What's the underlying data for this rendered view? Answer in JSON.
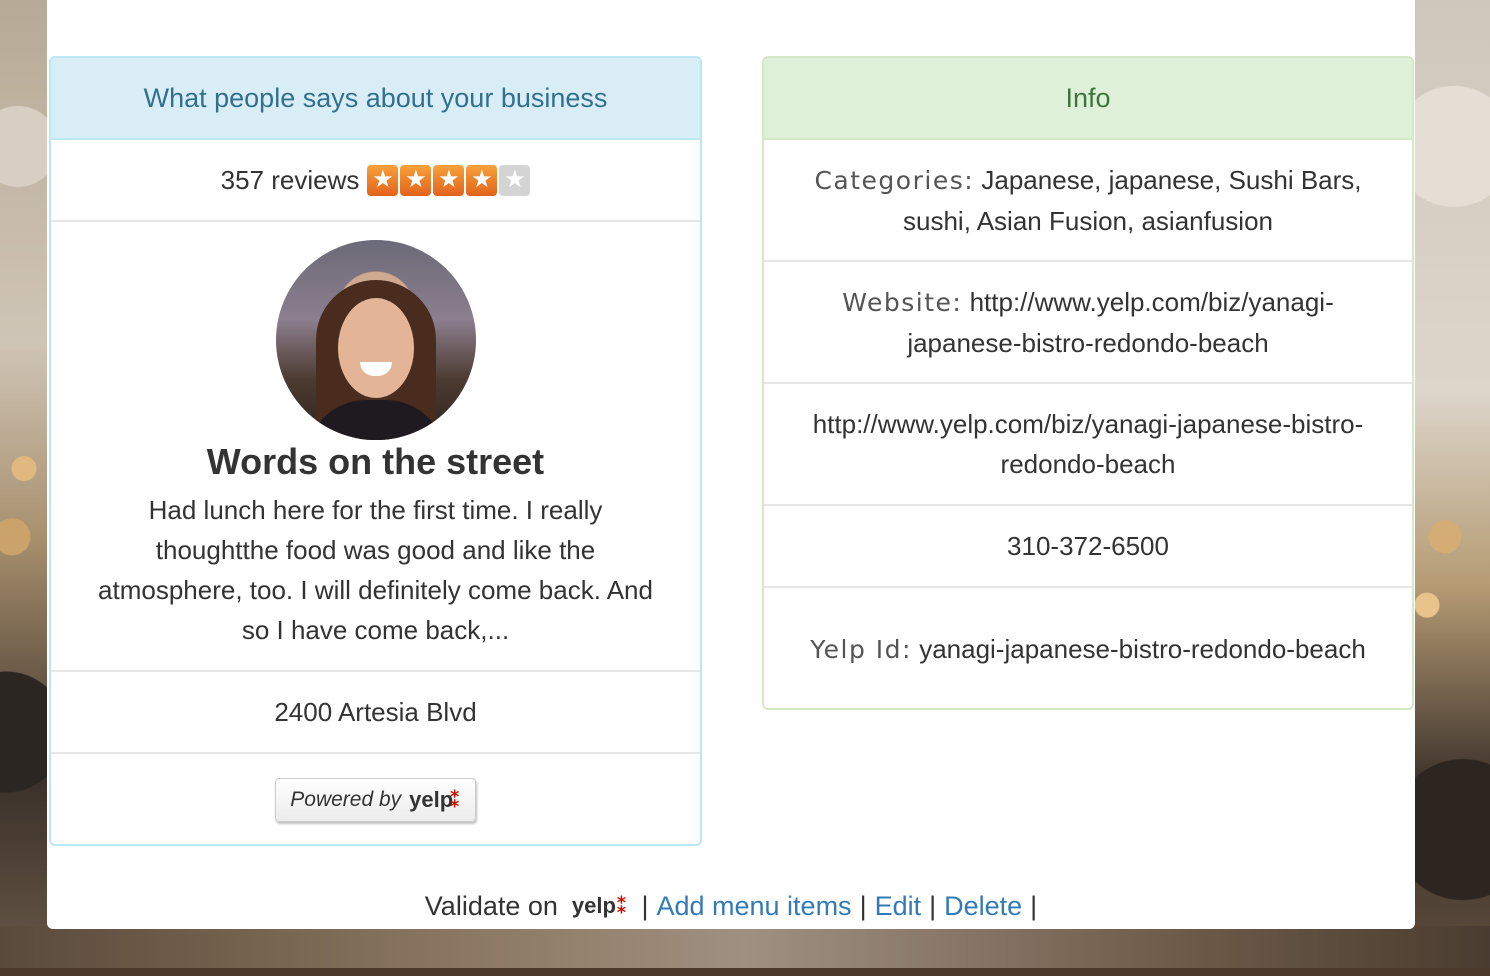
{
  "left_panel": {
    "heading": "What people says about your business",
    "review_count": "357 reviews",
    "rating": 4,
    "rating_max": 5,
    "review_title": "Words on the street",
    "review_text": "Had lunch here for the first time. I really thoughtthe food was good and like the atmosphere, too. I will definitely come back. And so I have come back,...",
    "address": "2400 Artesia Blvd",
    "powered_by": "Powered by",
    "powered_brand": "yelp"
  },
  "right_panel": {
    "heading": "Info",
    "categories_label": "Categories:",
    "categories_value": "Japanese, japanese, Sushi Bars, sushi, Asian Fusion, asianfusion",
    "website_label": "Website:",
    "website_value": "http://www.yelp.com/biz/yanagi-japanese-bistro-redondo-beach",
    "url": "http://www.yelp.com/biz/yanagi-japanese-bistro-redondo-beach",
    "phone": "310-372-6500",
    "yelp_id_label": "Yelp Id:",
    "yelp_id_value": "yanagi-japanese-bistro-redondo-beach"
  },
  "footer": {
    "validate_label": "Validate on",
    "validate_brand": "yelp",
    "sep": "|",
    "add_menu_items": "Add menu items",
    "edit": "Edit",
    "delete": "Delete"
  },
  "colors": {
    "left_heading_bg": "#d9edf7",
    "right_heading_bg": "#dff0d8",
    "link": "#337ab7",
    "star_on": "#f08a2c",
    "yelp_red": "#c41200"
  }
}
